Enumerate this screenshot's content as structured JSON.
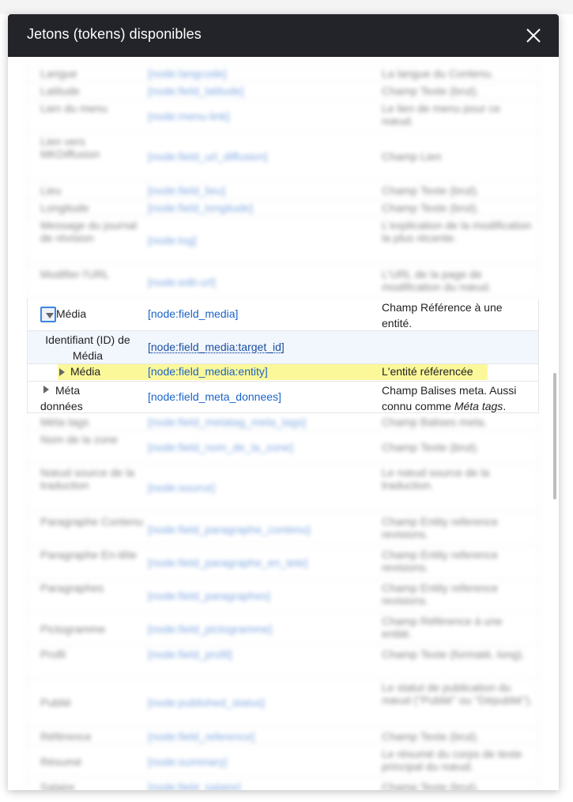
{
  "dialog": {
    "title": "Jetons (tokens) disponibles",
    "close_icon": "close-icon"
  },
  "rows_above": [
    {
      "name": "Langue",
      "token": "[node:langcode]",
      "desc": "La langue du Contenu."
    },
    {
      "name": "Latitude",
      "token": "[node:field_latitude]",
      "desc": "Champ Texte (brut)."
    },
    {
      "name": "Lien du menu",
      "token": "[node:menu-link]",
      "desc": "Le lien de menu pour ce nœud."
    },
    {
      "name": "Lien vers MKDiffusion",
      "token": "[node:field_url_diffusion]",
      "desc": "Champ Lien"
    },
    {
      "name": "Lieu",
      "token": "[node:field_lieu]",
      "desc": "Champ Texte (brut)."
    },
    {
      "name": "Longitude",
      "token": "[node:field_longitude]",
      "desc": "Champ Texte (brut)."
    },
    {
      "name": "Message du journal de révision",
      "token": "[node:log]",
      "desc": "L'explication de la modification la plus récente."
    },
    {
      "name": "Modifier l'URL",
      "token": "[node:edit-url]",
      "desc": "L'URL de la page de modification du nœud."
    }
  ],
  "media_row": {
    "name": "Média",
    "token": "[node:field_media]",
    "desc": "Champ Référence à une entité."
  },
  "target_row": {
    "name": "Identifiant (ID) de Média",
    "token": "[node:field_media:target_id]",
    "desc": ""
  },
  "entity_row": {
    "name": "Média",
    "token": "[node:field_media:entity]",
    "desc": "L'entité référencée"
  },
  "meta_row": {
    "name": "Méta données",
    "token": "[node:field_meta_donnees]",
    "desc_prefix": "Champ Balises meta. Aussi connu comme ",
    "desc_em": "Méta tags",
    "desc_suffix": "."
  },
  "rows_below": [
    {
      "name": "Méta tags",
      "token": "[node:field_metatag_meta_tags]",
      "desc": "Champ Balises meta."
    },
    {
      "name": "Nom de la zone",
      "token": "[node:field_nom_de_la_zone]",
      "desc": "Champ Texte (brut)."
    },
    {
      "name": "Nœud source de la traduction",
      "token": "[node:source]",
      "desc": "Le nœud source de la traduction."
    },
    {
      "name": "Paragraphe Contenu",
      "token": "[node:field_paragraphe_contenu]",
      "desc": "Champ Entity reference revisions."
    },
    {
      "name": "Paragraphe En-tête",
      "token": "[node:field_paragraphe_en_tete]",
      "desc": "Champ Entity reference revisions."
    },
    {
      "name": "Paragraphes",
      "token": "[node:field_paragraphes]",
      "desc": "Champ Entity reference revisions."
    },
    {
      "name": "Pictogramme",
      "token": "[node:field_pictogramme]",
      "desc": "Champ Référence à une entité."
    },
    {
      "name": "Profil",
      "token": "[node:field_profil]",
      "desc": "Champ Texte (formaté, long)."
    },
    {
      "name": "Publié",
      "token": "[node:published_status]",
      "desc": "Le statut de publication du nœud (\"Publié\" ou \"Dépublié\")."
    },
    {
      "name": "Référence",
      "token": "[node:field_reference]",
      "desc": "Champ Texte (brut)."
    },
    {
      "name": "Résumé",
      "token": "[node:summary]",
      "desc": "Le résumé du corps de texte principal du nœud."
    },
    {
      "name": "Salaire",
      "token": "[node:field_salaire]",
      "desc": "Champ Texte (brut)."
    }
  ]
}
